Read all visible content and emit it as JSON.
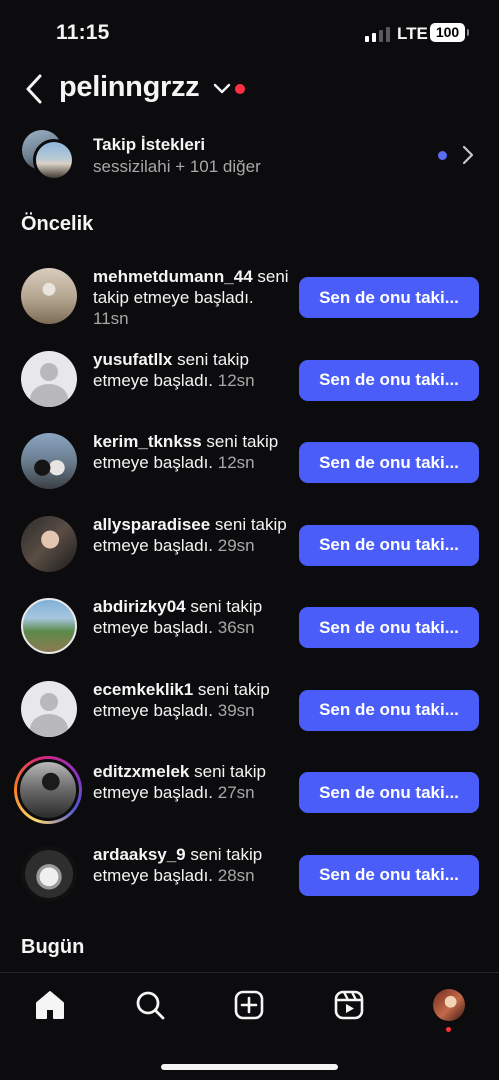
{
  "status_bar": {
    "time": "11:15",
    "network": "LTE",
    "battery": "100"
  },
  "header": {
    "username": "pelinngrzz"
  },
  "follow_requests": {
    "title": "Takip İstekleri",
    "subtitle": "sessizilahi + 101 diğer"
  },
  "sections": {
    "priority": "Öncelik",
    "today": "Bugün"
  },
  "follow_back_label": "Sen de onu taki...",
  "rows": [
    {
      "username": "mehmetdumann_44",
      "message": " seni takip etmeye başladı.",
      "time": " 11sn",
      "avatar": "photo"
    },
    {
      "username": "yusufatllx",
      "message": " seni takip etmeye başladı.",
      "time": " 12sn",
      "avatar": "default"
    },
    {
      "username": "kerim_tknkss",
      "message": " seni takip etmeye başladı.",
      "time": " 12sn",
      "avatar": "photo"
    },
    {
      "username": "allysparadisee",
      "message": " seni takip etmeye başladı.",
      "time": " 29sn",
      "avatar": "photo"
    },
    {
      "username": "abdirizky04",
      "message": " seni takip etmeye başladı.",
      "time": " 36sn",
      "avatar": "photo"
    },
    {
      "username": "ecemkeklik1",
      "message": " seni takip etmeye başladı.",
      "time": " 39sn",
      "avatar": "default"
    },
    {
      "username": "editzxmelek",
      "message": " seni takip etmeye başladı.",
      "time": " 27sn",
      "avatar": "story"
    },
    {
      "username": "ardaaksy_9",
      "message": " seni takip etmeye başladı.",
      "time": " 28sn",
      "avatar": "photo"
    }
  ],
  "tab_bar": [
    "home-icon",
    "search-icon",
    "create-icon",
    "reels-icon",
    "profile-avatar"
  ],
  "colors": {
    "accent": "#4a5df9",
    "notification": "#ff3040",
    "background": "#0c0c0e"
  }
}
